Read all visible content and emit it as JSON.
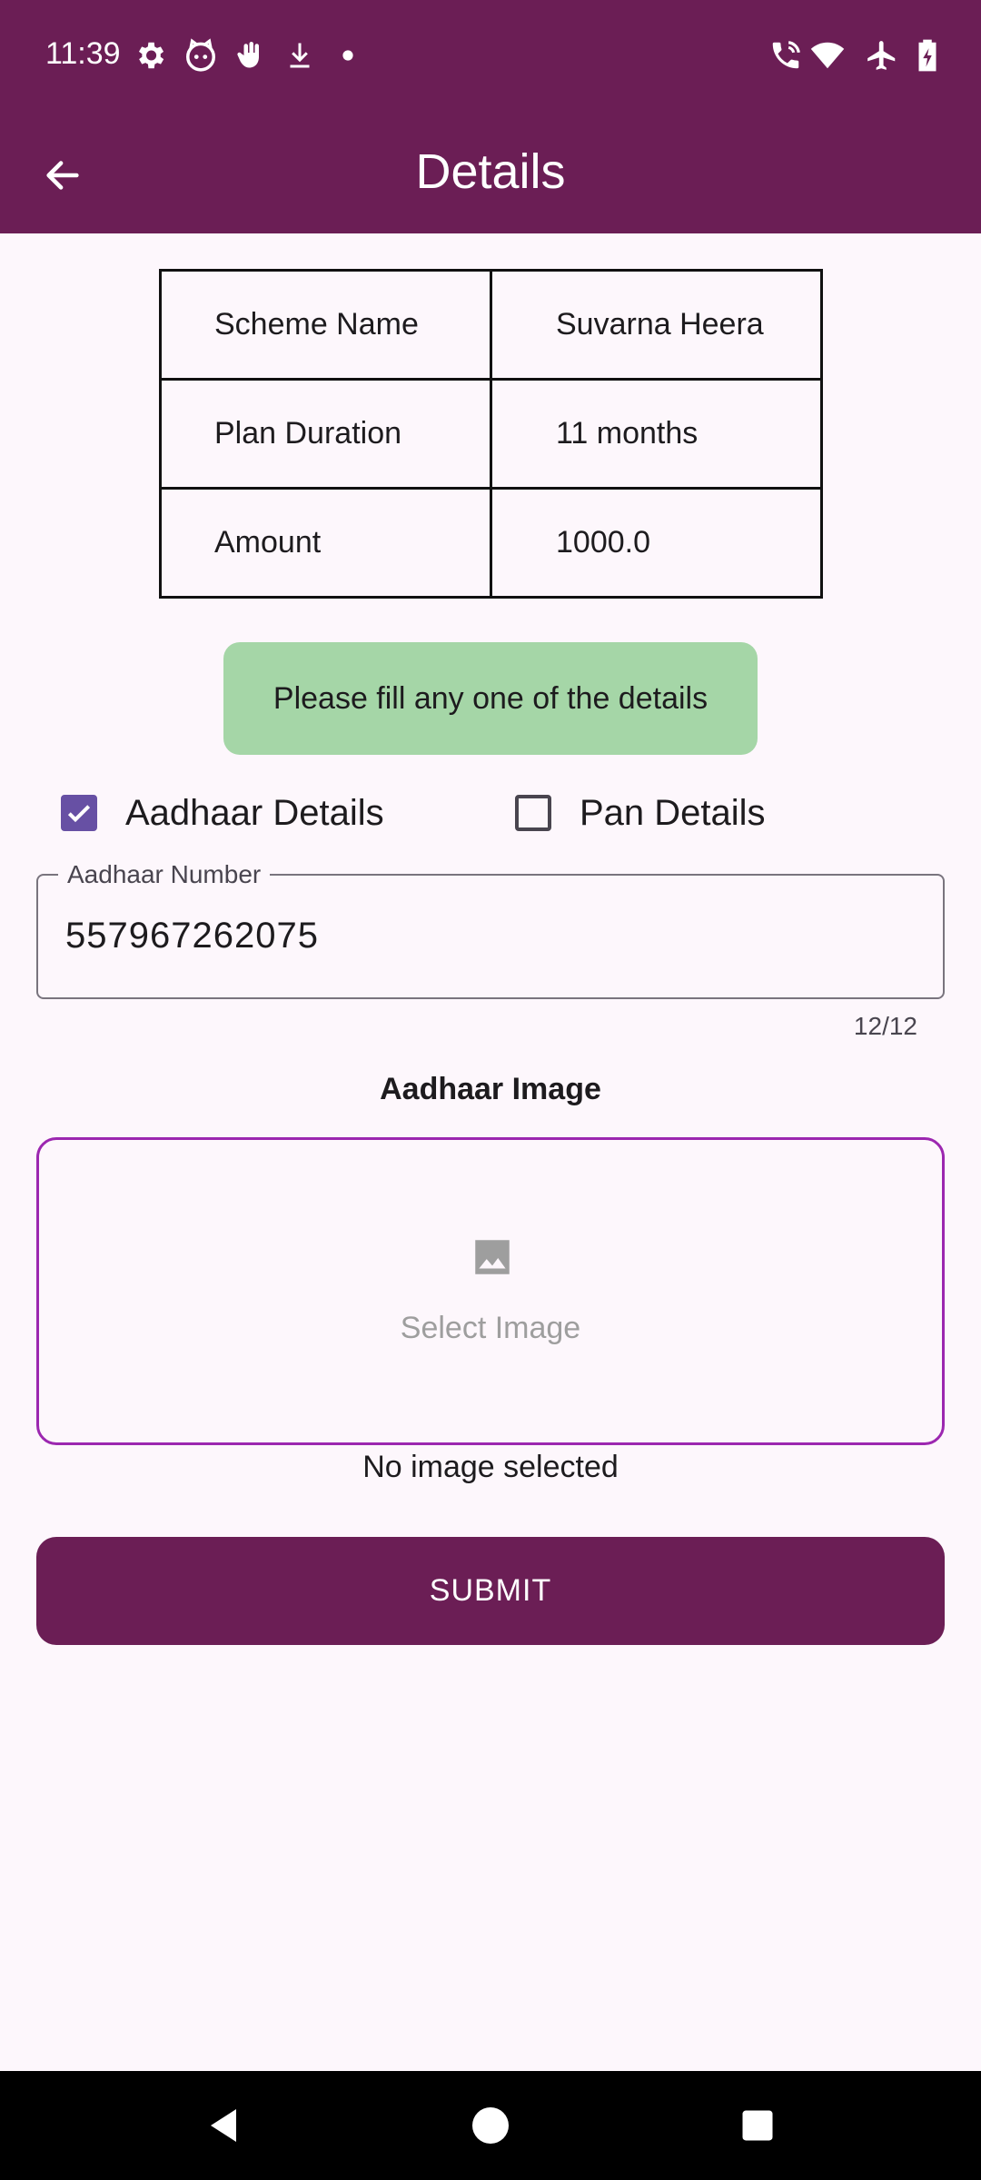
{
  "status_bar": {
    "time": "11:39",
    "left_icons": [
      "gear-icon",
      "cat-face-icon",
      "hand-icon",
      "download-icon",
      "dot-icon"
    ],
    "right_icons": [
      "wifi-calling-icon",
      "wifi-icon",
      "airplane-icon",
      "battery-charging-icon"
    ]
  },
  "app_bar": {
    "title": "Details",
    "back_icon": "arrow-left-icon",
    "color": "#6b1e55"
  },
  "info_table": {
    "rows": [
      {
        "label": "Scheme Name",
        "value": "Suvarna Heera"
      },
      {
        "label": "Plan Duration",
        "value": "11 months"
      },
      {
        "label": "Amount",
        "value": "1000.0"
      }
    ]
  },
  "notice": {
    "text": "Please fill any one of the details",
    "color": "#a5d6a7"
  },
  "options": {
    "aadhaar": {
      "label": "Aadhaar Details",
      "checked": true
    },
    "pan": {
      "label": "Pan Details",
      "checked": false
    }
  },
  "aadhaar_field": {
    "label": "Aadhaar Number",
    "value": "557967262075",
    "counter": "12/12"
  },
  "image_section": {
    "title": "Aadhaar Image",
    "picker_label": "Select Image",
    "picker_icon": "image-icon",
    "status": "No image selected"
  },
  "submit": {
    "label": "SUBMIT"
  },
  "nav_bar": {
    "buttons": [
      "back-triangle-icon",
      "home-circle-icon",
      "recents-square-icon"
    ]
  }
}
